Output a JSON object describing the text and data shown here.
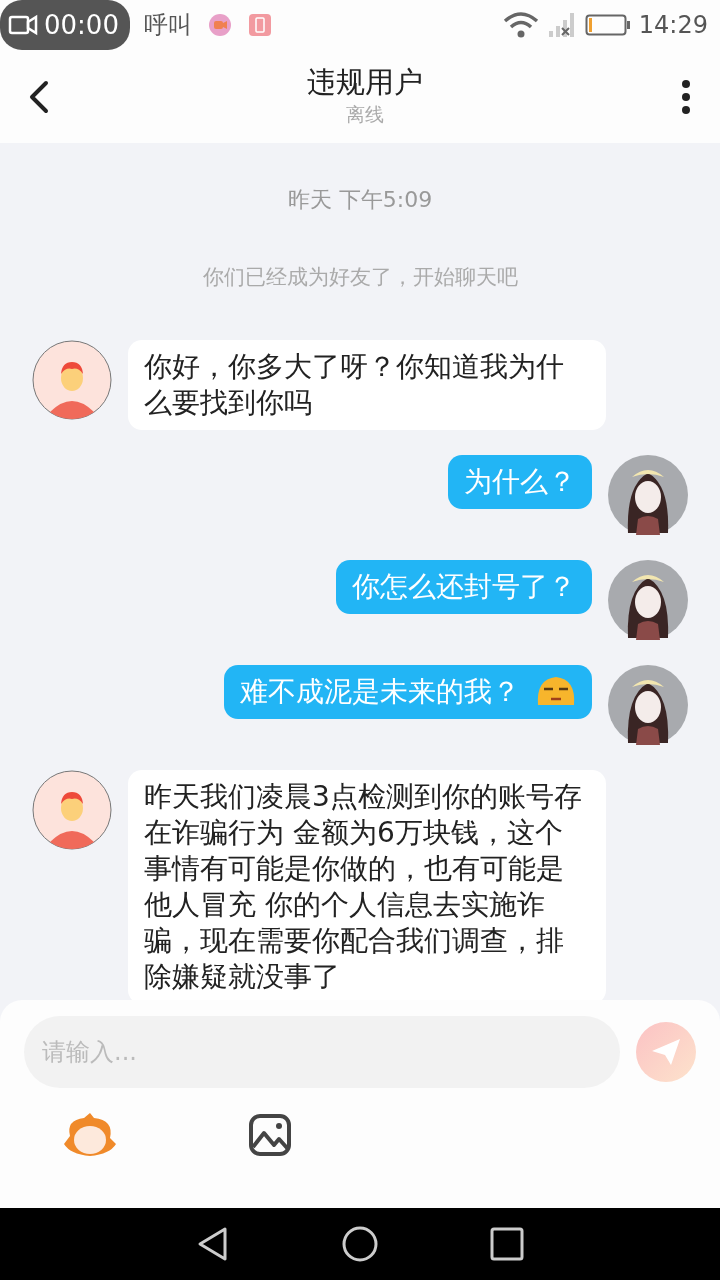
{
  "status_bar": {
    "recording_time": "00:00",
    "notification_text": "呼叫",
    "time": "14:29"
  },
  "header": {
    "title": "违规用户",
    "subtitle": "离线"
  },
  "messages": [
    {
      "kind": "time",
      "text": "昨天 下午5:09"
    },
    {
      "kind": "system",
      "text": "你们已经成为好友了，开始聊天吧"
    },
    {
      "kind": "incoming",
      "text": "你好，你多大了呀？你知道我为什么要找到你吗",
      "emoji": false
    },
    {
      "kind": "outgoing",
      "text": "为什么？",
      "emoji": false
    },
    {
      "kind": "outgoing",
      "text": "你怎么还封号了？",
      "emoji": false
    },
    {
      "kind": "outgoing",
      "text": "难不成泥是未来的我？",
      "emoji": true
    },
    {
      "kind": "incoming",
      "text": "昨天我们凌晨3点检测到你的账号存在诈骗行为 金额为6万块钱，这个事情有可能是你做的，也有可能是他人冒充 你的个人信息去实施诈骗，现在需要你配合我们调查，排除嫌疑就没事了",
      "emoji": false
    }
  ],
  "input": {
    "placeholder": "请输入..."
  }
}
